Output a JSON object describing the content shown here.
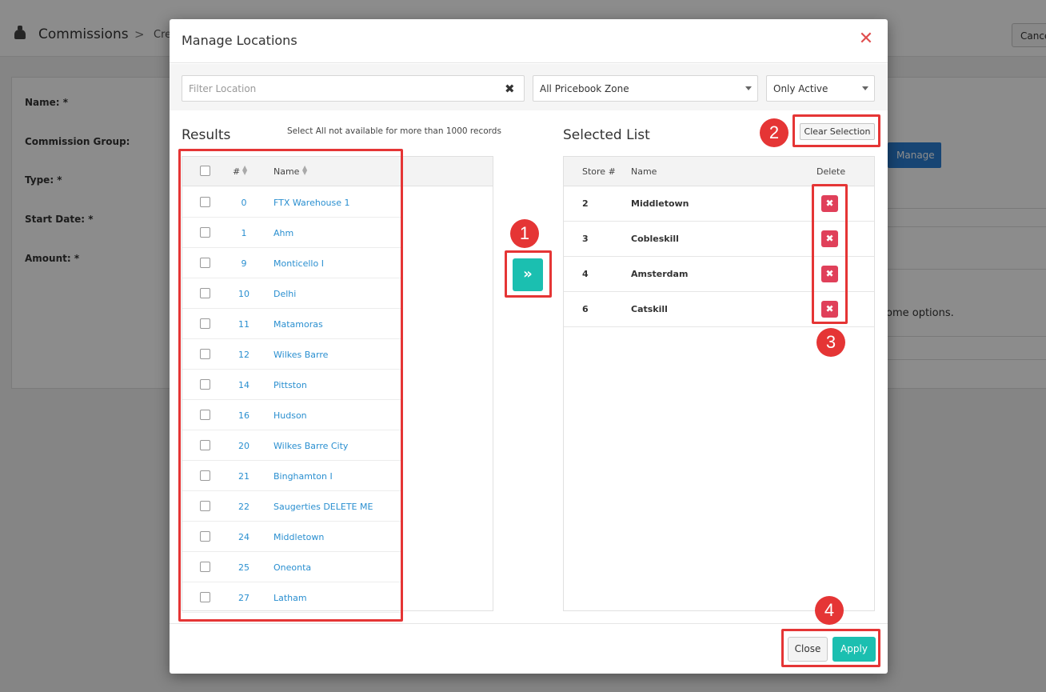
{
  "background": {
    "title": "Commissions",
    "breadcrumb": "Cre",
    "cancel_label": "Cance",
    "labels": [
      "Name: *",
      "Commission Group:",
      "Type: *",
      "Start Date: *",
      "Amount: *"
    ],
    "manage_label": "Manage",
    "options_text": "ome options."
  },
  "modal": {
    "title": "Manage Locations",
    "filter": {
      "placeholder": "Filter Location",
      "value": ""
    },
    "zone_select": "All Pricebook Zone",
    "status_select": "Only Active",
    "results_title": "Results",
    "results_note": "Select All not available for more than 1000 records",
    "results_columns": {
      "number": "#",
      "name": "Name"
    },
    "results_rows": [
      {
        "num": "0",
        "name": "FTX Warehouse 1"
      },
      {
        "num": "1",
        "name": "Ahm"
      },
      {
        "num": "9",
        "name": "Monticello I"
      },
      {
        "num": "10",
        "name": "Delhi"
      },
      {
        "num": "11",
        "name": "Matamoras"
      },
      {
        "num": "12",
        "name": "Wilkes Barre"
      },
      {
        "num": "14",
        "name": "Pittston"
      },
      {
        "num": "16",
        "name": "Hudson"
      },
      {
        "num": "20",
        "name": "Wilkes Barre City"
      },
      {
        "num": "21",
        "name": "Binghamton I"
      },
      {
        "num": "22",
        "name": "Saugerties DELETE ME"
      },
      {
        "num": "24",
        "name": "Middletown"
      },
      {
        "num": "25",
        "name": "Oneonta"
      },
      {
        "num": "27",
        "name": "Latham"
      }
    ],
    "move_icon": "»",
    "selected_title": "Selected List",
    "clear_label": "Clear Selection",
    "selected_columns": {
      "store": "Store #",
      "name": "Name",
      "delete": "Delete"
    },
    "selected_rows": [
      {
        "store": "2",
        "name": "Middletown"
      },
      {
        "store": "3",
        "name": "Cobleskill"
      },
      {
        "store": "4",
        "name": "Amsterdam"
      },
      {
        "store": "6",
        "name": "Catskill"
      }
    ],
    "delete_icon": "✖",
    "close_icon": "✕",
    "clear_filter_icon": "✖",
    "close_label": "Close",
    "apply_label": "Apply"
  },
  "annotations": [
    "1",
    "2",
    "3",
    "4"
  ],
  "colors": {
    "teal": "#1bbfb0",
    "link": "#2a8fd0",
    "danger": "#e0405a",
    "annotation": "#e53535"
  }
}
